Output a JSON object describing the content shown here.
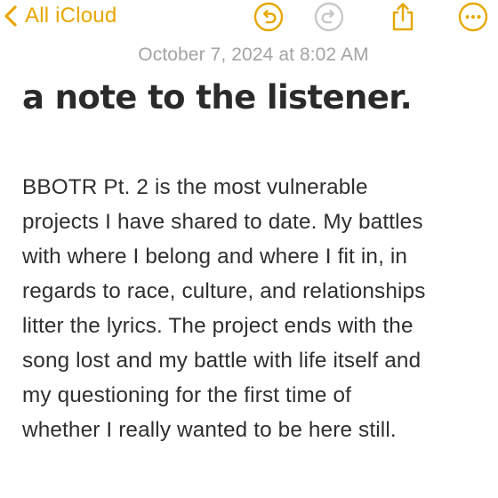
{
  "toolbar": {
    "back_label": "All iCloud",
    "accent_color": "#e6a700",
    "disabled_color": "#c8c8c8",
    "icons": [
      "chevron-left-icon",
      "undo-icon",
      "redo-icon",
      "share-icon",
      "more-icon"
    ]
  },
  "note": {
    "date": "October 7, 2024 at 8:02 AM",
    "title": "a note to the listener.",
    "body_lines": [
      "BBOTR Pt. 2 is the most vulnerable",
      "projects I have shared to date. My battles",
      "with where I belong and where I fit in, in",
      "regards to race, culture, and relationships",
      "litter the lyrics. The project ends with the",
      "song lost and my battle with life itself and",
      "my questioning for the first time of",
      "whether I really wanted to be here still."
    ]
  }
}
